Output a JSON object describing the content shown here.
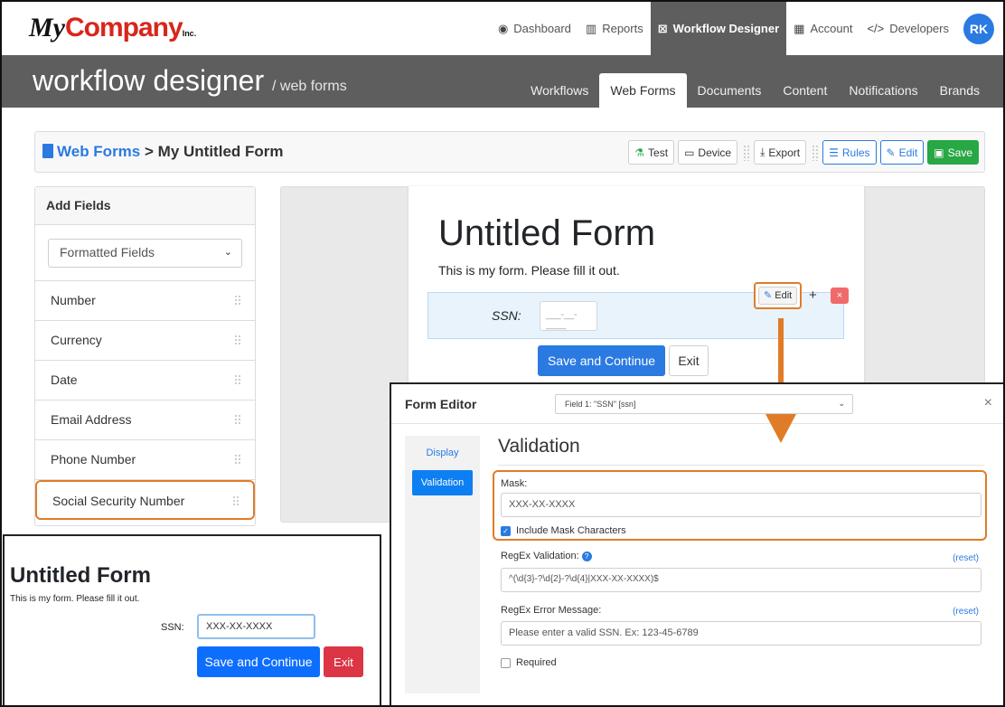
{
  "brand": {
    "logo_my": "My",
    "logo_company": "Company",
    "logo_inc": "Inc."
  },
  "topnav": {
    "items": [
      {
        "label": "Dashboard",
        "icon": "dashboard-icon"
      },
      {
        "label": "Reports",
        "icon": "chart-icon"
      },
      {
        "label": "Workflow Designer",
        "icon": "workflow-icon"
      },
      {
        "label": "Account",
        "icon": "building-icon"
      },
      {
        "label": "Developers",
        "icon": "code-icon"
      }
    ],
    "avatar": "RK"
  },
  "header": {
    "title": "workflow designer",
    "subtitle": "/ web forms",
    "tabs": [
      "Workflows",
      "Web Forms",
      "Documents",
      "Content",
      "Notifications",
      "Brands"
    ]
  },
  "breadcrumb": {
    "link": "Web Forms",
    "separator": ">",
    "current": "My Untitled Form"
  },
  "toolbar": {
    "test": "Test",
    "device": "Device",
    "export": "Export",
    "rules": "Rules",
    "edit": "Edit",
    "save": "Save"
  },
  "add_fields": {
    "title": "Add Fields",
    "select_value": "Formatted Fields",
    "items": [
      "Number",
      "Currency",
      "Date",
      "Email Address",
      "Phone Number",
      "Social Security Number"
    ]
  },
  "form": {
    "title": "Untitled Form",
    "description": "This is my form. Please fill it out.",
    "field_label": "SSN:",
    "field_mask_preview": "___-__-____",
    "edit": "Edit",
    "plus": "+",
    "remove": "×",
    "save": "Save and Continue",
    "exit": "Exit"
  },
  "editor": {
    "title": "Form Editor",
    "field_select": "Field 1: \"SSN\" [ssn]",
    "close": "×",
    "tabs": [
      "Display",
      "Validation"
    ],
    "section": "Validation",
    "mask_label": "Mask:",
    "mask_value": "XXX-XX-XXXX",
    "include_mask": "Include Mask Characters",
    "regex_label": "RegEx Validation:",
    "regex_value": "^(\\d{3}-?\\d{2}-?\\d{4}|XXX-XX-XXXX)$",
    "regex_reset": "(reset)",
    "error_label": "RegEx Error Message:",
    "error_value": "Please enter a valid SSN.  Ex: 123-45-6789",
    "error_reset": "(reset)",
    "required": "Required"
  },
  "preview": {
    "title": "Untitled Form",
    "description": "This is my form. Please fill it out.",
    "label": "SSN:",
    "value": "XXX-XX-XXXX",
    "save": "Save and Continue",
    "exit": "Exit"
  },
  "colors": {
    "accent": "#2a7ae2",
    "highlight": "#e07c28",
    "header_bg": "#5e5e5e",
    "save_green": "#28a745",
    "danger": "#dc3545"
  }
}
